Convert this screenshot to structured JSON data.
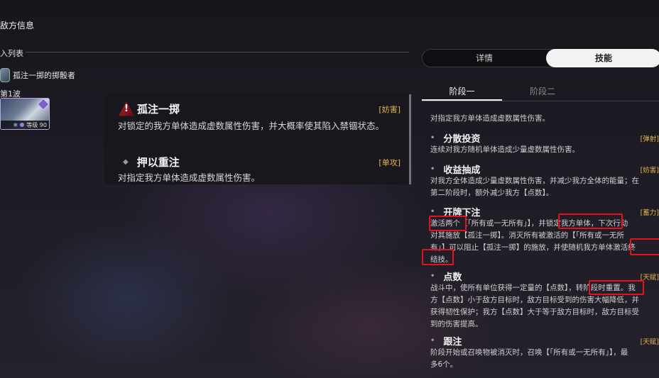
{
  "header": {
    "title": "敌方信息"
  },
  "enemy_list": {
    "section_label": "入列表",
    "enemy_name": "孤注一掷的掷骰者",
    "wave_label": "第1波",
    "card_level": "等级 90"
  },
  "tooltip": {
    "skill1": {
      "name": "孤注一掷",
      "tag": "[妨害]",
      "desc": "对锁定的我方单体造成虚数属性伤害，并大概率使其陷入禁锢状态。"
    },
    "skill2": {
      "name": "押以重注",
      "tag": "[单攻]",
      "desc": "对指定我方单体造成虚数属性伤害。"
    }
  },
  "tabs": {
    "detail": "详情",
    "skills": "技能"
  },
  "stages": {
    "stage1": "阶段一",
    "stage2": "阶段二"
  },
  "skills": [
    {
      "name": "",
      "tag": "",
      "desc": [
        "对指定我方单体造成虚数属性伤害。"
      ]
    },
    {
      "name": "分散投资",
      "tag": "[弹射]",
      "desc": [
        "连续对我方随机单体造成少量虚数属性伤害。"
      ]
    },
    {
      "name": "收益抽成",
      "tag": "[妨害]",
      "desc": [
        "对我方全体造成少量虚数属性伤害，并减少我方全体的能量；在",
        "第二阶段时，额外减少我方【点数】。"
      ]
    },
    {
      "name": "开牌下注",
      "tag": "[蓄力]",
      "desc": [
        "激活两个【「所有或一无所有」】，并锁定我方单体，下次行动",
        "对其施放【孤注一掷】。消灭所有被激活的【「所有或一无所",
        "有」】可以阻止【孤注一掷】的施放，并使随机我方单体激活终",
        "结技。"
      ]
    },
    {
      "name": "点数",
      "tag": "[天赋]",
      "desc": [
        "战斗中，使所有单位获得一定量的【点数】，转阶段时重置。我",
        "方【点数】小于敌方目标时，敌方目标受到的伤害大幅降低，并",
        "获得韧性保护；我方【点数】大于等于敌方目标时，敌方目标受",
        "到的伤害提高。"
      ]
    },
    {
      "name": "跟注",
      "tag": "[天赋]",
      "desc": [
        "阶段开始或召唤物被消灭时，召唤【「所有或一无所有」】，最",
        "多6个。"
      ]
    }
  ],
  "colors": {
    "tag": "#e6b24c",
    "highlight": "#e3121d",
    "active_tab_bg": "#f2f2f2"
  },
  "icons": [
    "warning-icon",
    "enemy-portrait-icon",
    "ice-element-icon",
    "quantum-element-icon"
  ]
}
